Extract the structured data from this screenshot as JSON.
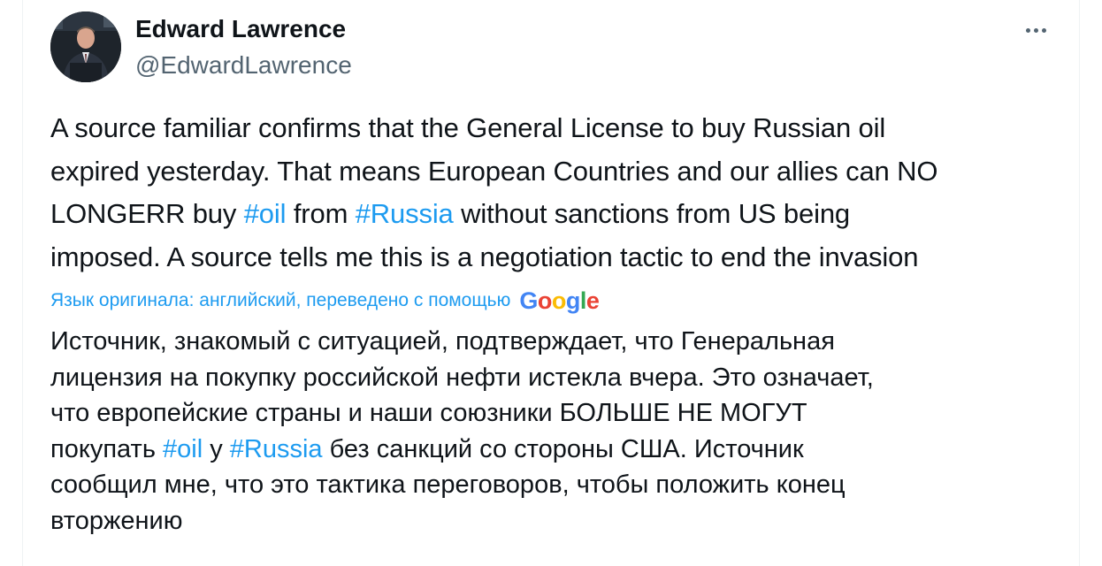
{
  "author": {
    "name": "Edward Lawrence",
    "handle": "@EdwardLawrence"
  },
  "more_icon": "ellipsis-icon",
  "tweet": {
    "lines": [
      [
        {
          "t": "A source familiar confirms that the General License to buy Russian oil"
        }
      ],
      [
        {
          "t": "expired yesterday. That means European Countries and our allies can NO"
        }
      ],
      [
        {
          "t": "LONGERR buy "
        },
        {
          "t": "#oil",
          "tag": true
        },
        {
          "t": " from "
        },
        {
          "t": "#Russia",
          "tag": true
        },
        {
          "t": " without sanctions from US being"
        }
      ],
      [
        {
          "t": "imposed. A source tells me this is a negotiation tactic to end the invasion"
        }
      ]
    ]
  },
  "translation": {
    "label": "Язык оригинала: английский, переведено с помощью",
    "provider": "Google",
    "lines": [
      [
        {
          "t": "Источник, знакомый с ситуацией, подтверждает, что Генеральная"
        }
      ],
      [
        {
          "t": "лицензия на покупку российской нефти истекла вчера. Это означает,"
        }
      ],
      [
        {
          "t": "что европейские страны и наши союзники БОЛЬШЕ НЕ МОГУТ"
        }
      ],
      [
        {
          "t": "покупать "
        },
        {
          "t": "#oil",
          "tag": true
        },
        {
          "t": " у "
        },
        {
          "t": "#Russia",
          "tag": true
        },
        {
          "t": " без санкций со стороны США. Источник"
        }
      ],
      [
        {
          "t": "сообщил мне, что это тактика переговоров, чтобы положить конец"
        }
      ],
      [
        {
          "t": "вторжению"
        }
      ]
    ]
  },
  "colors": {
    "link": "#1d9bf0",
    "secondary_text": "#536471",
    "primary_text": "#0f1419"
  }
}
